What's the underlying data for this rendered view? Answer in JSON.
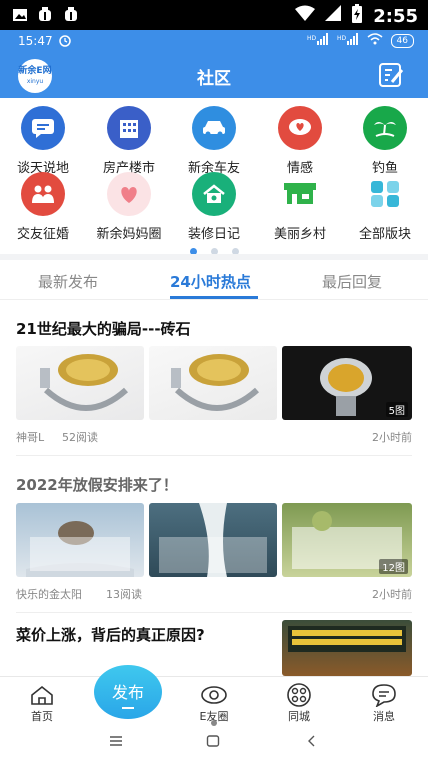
{
  "system": {
    "time": "2:55"
  },
  "app_status": {
    "time": "15:47",
    "battery": "46"
  },
  "header": {
    "title": "社区",
    "logo_line1": "新余E网",
    "logo_line2": "xinyu"
  },
  "categories": [
    {
      "label": "谈天说地",
      "icon": "chat-icon",
      "color": "#2f6fd6"
    },
    {
      "label": "房产楼市",
      "icon": "building-icon",
      "color": "#3a5fc8"
    },
    {
      "label": "新余车友",
      "icon": "car-icon",
      "color": "#2f8ee0"
    },
    {
      "label": "情感",
      "icon": "heart-chat-icon",
      "color": "#e24b3f"
    },
    {
      "label": "钓鱼",
      "icon": "palm-icon",
      "color": "#18a84a"
    },
    {
      "label": "交友征婚",
      "icon": "couple-icon",
      "color": "#e24b3f"
    },
    {
      "label": "新余妈妈圈",
      "icon": "mom-heart-icon",
      "color": "#f4a0a5"
    },
    {
      "label": "装修日记",
      "icon": "house-icon",
      "color": "#19b07a"
    },
    {
      "label": "美丽乡村",
      "icon": "market-icon",
      "color": "#2fb24a"
    },
    {
      "label": "全部版块",
      "icon": "grid-icon",
      "color": "#37b7d8"
    }
  ],
  "tabs": [
    "最新发布",
    "24小时热点",
    "最后回复"
  ],
  "posts": [
    {
      "title": "21世纪最大的骗局---砖石",
      "author": "神哥L",
      "reads": "52阅读",
      "time": "2小时前",
      "badge": "5图"
    },
    {
      "title": "2022年放假安排来了！",
      "author": "快乐的金太阳",
      "reads": "13阅读",
      "time": "2小时前",
      "badge": "12图"
    },
    {
      "title": "菜价上涨，背后的真正原因?"
    }
  ],
  "nav": {
    "home": "首页",
    "publish": "发布",
    "efriends": "E友圈",
    "city": "同城",
    "messages": "消息"
  }
}
